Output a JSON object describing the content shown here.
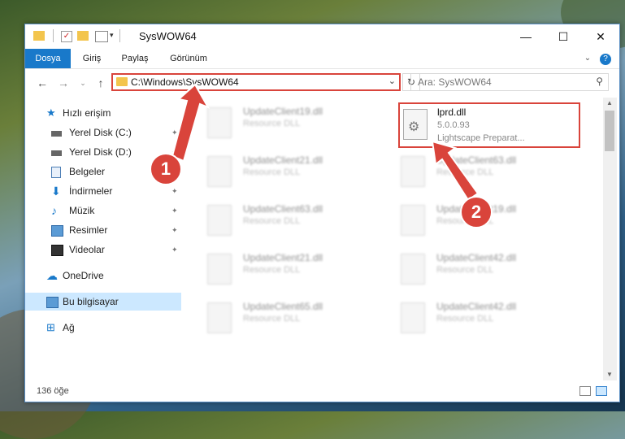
{
  "window": {
    "title": "SysWOW64"
  },
  "ribbon": {
    "tabs": [
      "Dosya",
      "Giriş",
      "Paylaş",
      "Görünüm"
    ]
  },
  "address": {
    "path": "C:\\Windows\\SysWOW64"
  },
  "search": {
    "placeholder": "Ara: SysWOW64"
  },
  "sidebar": {
    "items": [
      {
        "label": "Hızlı erişim",
        "icon": "star-icon",
        "pinned": false
      },
      {
        "label": "Yerel Disk (C:)",
        "icon": "drive-icon",
        "pinned": true
      },
      {
        "label": "Yerel Disk (D:)",
        "icon": "drive-icon",
        "pinned": true
      },
      {
        "label": "Belgeler",
        "icon": "document-icon",
        "pinned": true
      },
      {
        "label": "İndirmeler",
        "icon": "download-icon",
        "pinned": true
      },
      {
        "label": "Müzik",
        "icon": "music-icon",
        "pinned": true
      },
      {
        "label": "Resimler",
        "icon": "pictures-icon",
        "pinned": true
      },
      {
        "label": "Videolar",
        "icon": "video-icon",
        "pinned": true
      },
      {
        "label": "OneDrive",
        "icon": "cloud-icon",
        "pinned": false
      },
      {
        "label": "Bu bilgisayar",
        "icon": "computer-icon",
        "pinned": false
      },
      {
        "label": "Ağ",
        "icon": "network-icon",
        "pinned": false
      }
    ]
  },
  "files": {
    "highlighted": {
      "name": "lprd.dll",
      "version": "5.0.0.93",
      "description": "Lightscape Preparat..."
    },
    "left_column": [
      {
        "name": "UpdateClient19.dll",
        "desc": "Resource DLL"
      },
      {
        "name": "UpdateClient21.dll",
        "desc": "Resource DLL"
      },
      {
        "name": "UpdateClient63.dll",
        "desc": "Resource DLL"
      },
      {
        "name": "UpdateClient21.dll",
        "desc": "Resource DLL"
      },
      {
        "name": "UpdateClient65.dll",
        "desc": "Resource DLL"
      }
    ],
    "right_column": [
      {
        "name": "UpdateClient63.dll",
        "desc": "Resource DLL"
      },
      {
        "name": "UpdateClient19.dll",
        "desc": "Resource DLL"
      },
      {
        "name": "UpdateClient42.dll",
        "desc": "Resource DLL"
      },
      {
        "name": "UpdateClient42.dll",
        "desc": "Resource DLL"
      }
    ]
  },
  "status": {
    "count": "136 öğe"
  },
  "markers": {
    "one": "1",
    "two": "2"
  },
  "colors": {
    "accent": "#1979ca",
    "highlight": "#d9443b",
    "selection": "#cce8ff"
  }
}
